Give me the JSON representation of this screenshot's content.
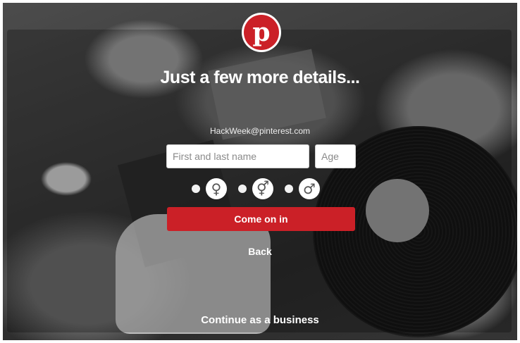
{
  "brand": {
    "logo_letter": "p",
    "color": "#cb2027"
  },
  "heading": "Just a few more details...",
  "account_email": "HackWeek@pinterest.com",
  "form": {
    "name_placeholder": "First and last name",
    "age_placeholder": "Age",
    "gender_options": [
      {
        "icon": "female-icon",
        "symbol": "♀"
      },
      {
        "icon": "transgender-icon",
        "symbol": "⚥"
      },
      {
        "icon": "male-icon",
        "symbol": "♂"
      }
    ],
    "submit_label": "Come on in"
  },
  "back_label": "Back",
  "business_label": "Continue as a business"
}
